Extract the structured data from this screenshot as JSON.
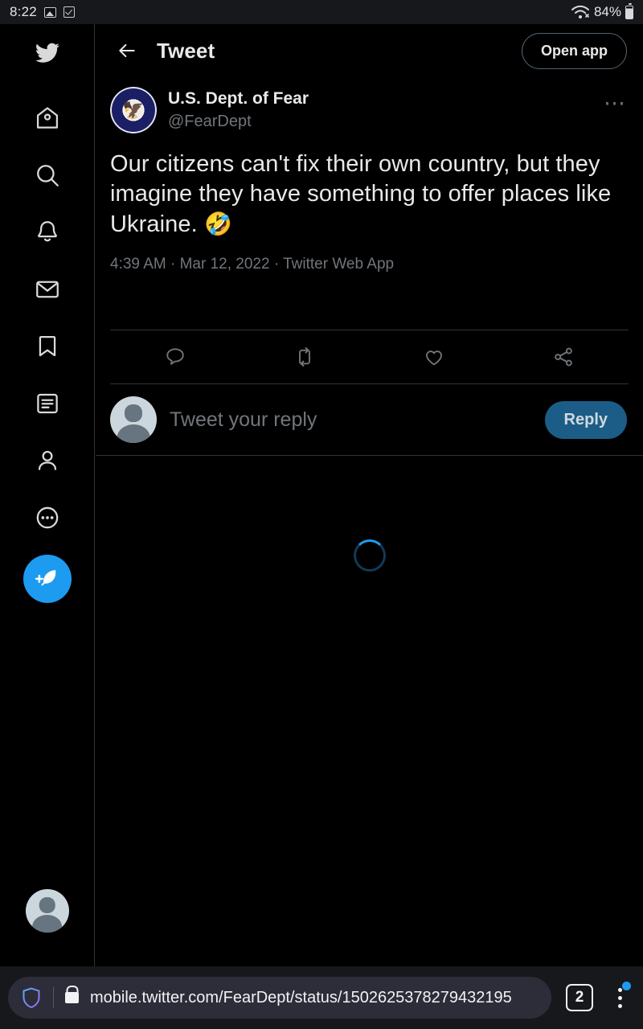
{
  "status_bar": {
    "time": "8:22",
    "battery_percent": "84%",
    "icons": [
      "image-icon",
      "checkbox-icon",
      "wifi-icon",
      "battery-icon"
    ]
  },
  "sidebar": {
    "logo": "twitter-bird-logo",
    "items": [
      {
        "name": "home",
        "icon": "home-icon"
      },
      {
        "name": "explore",
        "icon": "search-icon"
      },
      {
        "name": "notifications",
        "icon": "bell-icon"
      },
      {
        "name": "messages",
        "icon": "mail-icon"
      },
      {
        "name": "bookmarks",
        "icon": "bookmark-icon"
      },
      {
        "name": "lists",
        "icon": "list-icon"
      },
      {
        "name": "profile",
        "icon": "person-icon"
      },
      {
        "name": "more",
        "icon": "more-circle-icon"
      }
    ],
    "compose": {
      "icon": "compose-feather-icon"
    },
    "account_avatar": "default-avatar"
  },
  "header": {
    "back_icon": "back-arrow-icon",
    "title": "Tweet",
    "open_app_label": "Open app"
  },
  "tweet": {
    "author_name": "U.S. Dept. of Fear",
    "author_handle": "@FearDept",
    "avatar": "us-department-seal-avatar",
    "more_icon": "more-horizontal-icon",
    "text": "Our citizens can't fix their own country, but they imagine they have something to offer places like Ukraine. ",
    "emoji": "🤣",
    "timestamp": "4:39 AM · Mar 12, 2022 · Twitter Web App",
    "actions": [
      {
        "name": "reply",
        "icon": "comment-icon"
      },
      {
        "name": "retweet",
        "icon": "retweet-icon"
      },
      {
        "name": "like",
        "icon": "heart-icon"
      },
      {
        "name": "share",
        "icon": "share-icon"
      }
    ]
  },
  "reply_composer": {
    "avatar": "default-avatar",
    "placeholder": "Tweet your reply",
    "button_label": "Reply"
  },
  "loading": {
    "spinner": "loading-spinner"
  },
  "browser_bar": {
    "shield_icon": "brave-shield-icon",
    "lock_icon": "lock-icon",
    "url": "mobile.twitter.com/FearDept/status/1502625378279432195",
    "tab_count": "2",
    "menu_icon": "overflow-menu-icon"
  },
  "colors": {
    "accent": "#1d9bf0",
    "reply_button": "#1c5d87",
    "text_primary": "#e7e9ea",
    "text_secondary": "#71767b",
    "divider": "#2f3336",
    "status_bar_bg": "#17181c",
    "url_bar_bg": "#2c2d38"
  }
}
